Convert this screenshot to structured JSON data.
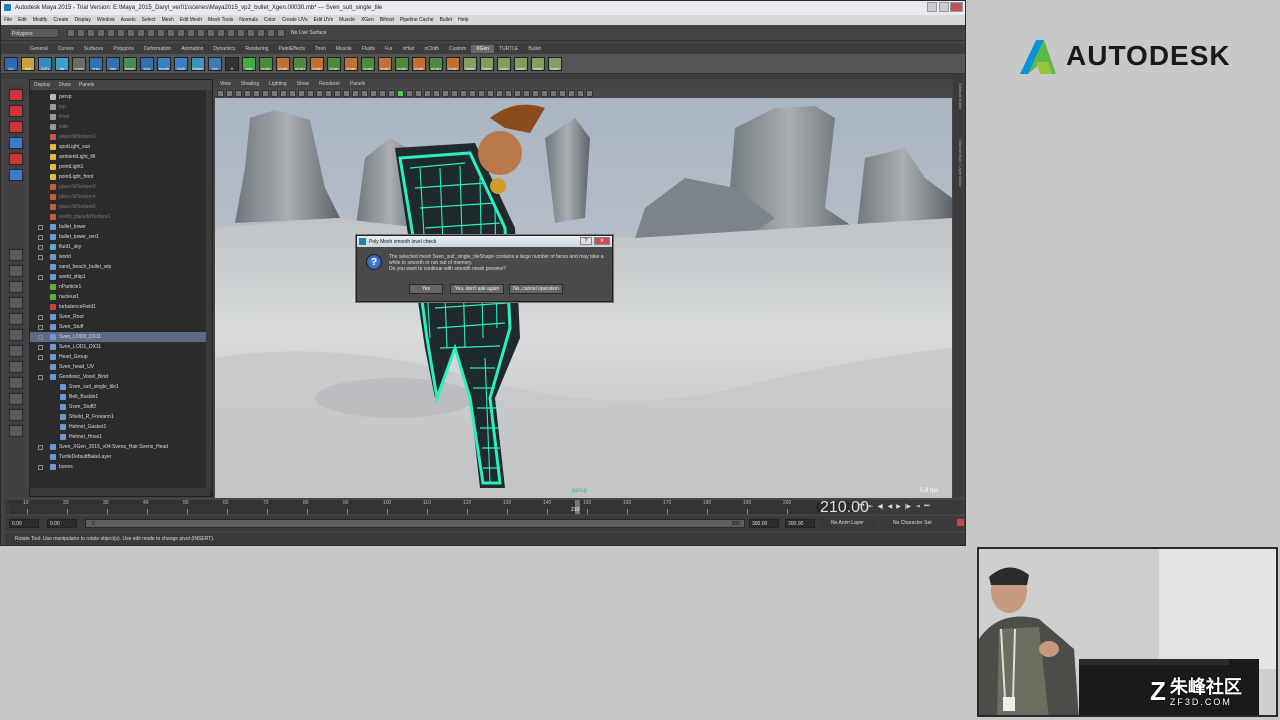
{
  "window": {
    "title": "Autodesk Maya 2015 - Trial Version: E:\\Maya_2015_Daryl_ver01\\scenes\\Maya2015_vp2_bullet_Xgen.00030.mb* --- Sven_suit_single_tile"
  },
  "menubar": [
    "File",
    "Edit",
    "Modify",
    "Create",
    "Display",
    "Window",
    "Assets",
    "Select",
    "Mesh",
    "Edit Mesh",
    "Mesh Tools",
    "Normals",
    "Color",
    "Create UVs",
    "Edit UVs",
    "Muscle",
    "XGen",
    "Bifrost",
    "Pipeline Cache",
    "Bullet",
    "Help"
  ],
  "statusline": {
    "mode": "Polygons",
    "live_surface": "No Live Surface"
  },
  "shelf": {
    "tabs": [
      "General",
      "Curves",
      "Surfaces",
      "Polygons",
      "Deformation",
      "Animation",
      "Dynamics",
      "Rendering",
      "PaintEffects",
      "Toon",
      "Muscle",
      "Fluids",
      "Fur",
      "nHair",
      "nCloth",
      "Custom",
      "XGen",
      "TURTLE",
      "Bullet"
    ],
    "active_tab": "XGen",
    "icons": [
      "UV",
      "first",
      "GZN",
      "rig",
      "voxel",
      "ship",
      "hair",
      "tower",
      "ship",
      "break",
      "cloth",
      "beach",
      "tex",
      "X",
      "eye",
      "chain",
      "chain",
      "chain",
      "chain",
      "chain",
      "chain",
      "chain",
      "chain",
      "chain",
      "chain",
      "chain",
      "chain",
      "bone",
      "bone",
      "bone",
      "bone",
      "bone",
      "bone"
    ]
  },
  "outliner": {
    "menu": [
      "Display",
      "Show",
      "Panels"
    ],
    "items": [
      {
        "label": "persp",
        "color": "#bbbbbb",
        "indent": 1
      },
      {
        "label": "top",
        "color": "#999999",
        "indent": 1,
        "dim": true
      },
      {
        "label": "front",
        "color": "#999999",
        "indent": 1,
        "dim": true
      },
      {
        "label": "side",
        "color": "#999999",
        "indent": 1,
        "dim": true
      },
      {
        "label": "place3dTexture1",
        "color": "#c06040",
        "indent": 1,
        "dim": true
      },
      {
        "label": "spotLight_sun",
        "color": "#e0c040",
        "indent": 1
      },
      {
        "label": "ambientLight_fill",
        "color": "#e0c040",
        "indent": 1
      },
      {
        "label": "pointLight1",
        "color": "#e0c040",
        "indent": 1
      },
      {
        "label": "pointLight_front",
        "color": "#e0c040",
        "indent": 1
      },
      {
        "label": "place3dTexture3",
        "color": "#c06040",
        "indent": 1,
        "dim": true
      },
      {
        "label": "place3dTexture4",
        "color": "#c06040",
        "indent": 1,
        "dim": true
      },
      {
        "label": "place3dTexture5",
        "color": "#c06040",
        "indent": 1,
        "dim": true
      },
      {
        "label": "world_place3dTexture1",
        "color": "#c06040",
        "indent": 1,
        "dim": true
      },
      {
        "label": "bullet_tower",
        "color": "#6a9ad0",
        "indent": 1,
        "exp": true
      },
      {
        "label": "bullet_tower_ren1",
        "color": "#6a9ad0",
        "indent": 1,
        "exp": true
      },
      {
        "label": "fluid1_sky",
        "color": "#5ab0d0",
        "indent": 1,
        "exp": true
      },
      {
        "label": "world",
        "color": "#6a9ad0",
        "indent": 1,
        "exp": true
      },
      {
        "label": "sand_beach_bullet_wip",
        "color": "#6a9ad0",
        "indent": 1
      },
      {
        "label": "world_ship1",
        "color": "#6a9ad0",
        "indent": 1,
        "exp": true
      },
      {
        "label": "nParticle1",
        "color": "#60b040",
        "indent": 1
      },
      {
        "label": "nucleus1",
        "color": "#60b040",
        "indent": 1
      },
      {
        "label": "turbulenceField1",
        "color": "#d04040",
        "indent": 1
      },
      {
        "label": "Sven_Root",
        "color": "#6a9ad0",
        "indent": 1,
        "exp": true
      },
      {
        "label": "Sven_Stuff",
        "color": "#6a9ad0",
        "indent": 1,
        "exp": true
      },
      {
        "label": "Sven_LOD0_DX11",
        "color": "#6a9ad0",
        "indent": 1,
        "exp": true,
        "sel": true
      },
      {
        "label": "Sven_LOD1_DX11",
        "color": "#6a9ad0",
        "indent": 1,
        "exp": true
      },
      {
        "label": "Head_Group",
        "color": "#6a9ad0",
        "indent": 1,
        "exp": true
      },
      {
        "label": "Sven_head_UV",
        "color": "#6a9ad0",
        "indent": 1
      },
      {
        "label": "Geodesic_Voxel_Bind",
        "color": "#6a9ad0",
        "indent": 1,
        "exp": true
      },
      {
        "label": "Sven_suit_single_tile1",
        "color": "#6a9ad0",
        "indent": 2
      },
      {
        "label": "Belt_Buckle1",
        "color": "#6a9ad0",
        "indent": 2
      },
      {
        "label": "Sven_Stuff2",
        "color": "#6a9ad0",
        "indent": 2
      },
      {
        "label": "Shield_R_Forearm1",
        "color": "#6a9ad0",
        "indent": 2
      },
      {
        "label": "Helmet_Gasket1",
        "color": "#6a9ad0",
        "indent": 2
      },
      {
        "label": "Helmet_Hose1",
        "color": "#6a9ad0",
        "indent": 2
      },
      {
        "label": "Sven_XGen_2015_v04:Svens_Hair:Svens_Head",
        "color": "#6a9ad0",
        "indent": 1,
        "exp": true
      },
      {
        "label": "TurtleDefaultBakeLayer",
        "color": "#6a9ad0",
        "indent": 1
      },
      {
        "label": "bones",
        "color": "#6a9ad0",
        "indent": 1,
        "exp": true
      }
    ]
  },
  "viewport": {
    "menu": [
      "View",
      "Shading",
      "Lighting",
      "Show",
      "Renderer",
      "Panels"
    ],
    "camera_label": "persp",
    "fps": "5.8 fps",
    "colors": {
      "wireframe": "#2af0c0",
      "sky": "#b4bec8",
      "ground": "#d0d2d4"
    }
  },
  "side_tabs": [
    "Attribute Editor",
    "Channel Box / Layer Editor"
  ],
  "timeline": {
    "ticks": [
      "10",
      "20",
      "30",
      "40",
      "50",
      "60",
      "70",
      "80",
      "90",
      "100",
      "110",
      "120",
      "130",
      "140",
      "150",
      "160",
      "170",
      "180",
      "190",
      "200"
    ],
    "current_frame": "210",
    "current_field": "210.00"
  },
  "range": {
    "start": "0.00",
    "start2": "0.00",
    "slider_start": "0",
    "slider_end": "300",
    "end1": "300.00",
    "end2": "300.00",
    "anim_layer": "No Anim Layer",
    "char_set": "No Character Set"
  },
  "helpline": "Rotate Tool: Use manipulator to rotate object(s). Use edit mode to change pivot (INSERT).",
  "dialog": {
    "title": "Poly Mesh smooth level check",
    "message": "The selected mesh Sven_suit_single_tileShape contains a large number of faces and may take a while to smooth or run out of memory.\nDo you want to continue with smooth mesh preview?",
    "buttons": [
      "Yes",
      "Yes, don't ask again",
      "No, cancel operation"
    ],
    "icon": "question-icon"
  },
  "logo": {
    "text": "AUTODESK",
    "colors": [
      "#0696d7",
      "#5cb946",
      "#9ac43c"
    ]
  },
  "watermark": {
    "chinese": "朱峰社区",
    "url": "ZF3D.COM"
  }
}
